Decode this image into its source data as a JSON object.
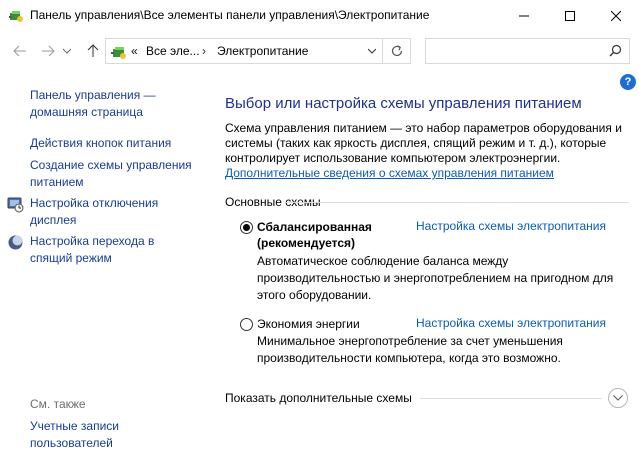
{
  "window": {
    "title": "Панель управления\\Все элементы панели управления\\Электропитание"
  },
  "address": {
    "overflow": "«",
    "crumb1": "Все эле...",
    "crumb2": "Электропитание"
  },
  "search": {
    "placeholder": ""
  },
  "help_label": "?",
  "sidebar": {
    "home": "Панель управления — домашняя страница",
    "links": [
      "Действия кнопок питания",
      "Создание схемы управления питанием",
      "Настройка отключения дисплея",
      "Настройка перехода в спящий режим"
    ],
    "see_also": "См. также",
    "user_accounts": "Учетные записи пользователей"
  },
  "main": {
    "title": "Выбор или настройка схемы управления питанием",
    "intro": "Схема управления питанием — это набор параметров оборудования и системы (таких как яркость дисплея, спящий режим и т. д.), которые контролирует использование компьютером электроэнергии.",
    "more_link": "Дополнительные сведения о схемах управления питанием",
    "section_label": "Основные схемы",
    "plans": [
      {
        "name": "Сбалансированная (рекомендуется)",
        "settings": "Настройка схемы электропитания",
        "description": "Автоматическое соблюдение баланса между производительностью и энергопотреблением на пригодном для этого оборудовании.",
        "selected": true
      },
      {
        "name": "Экономия энергии",
        "settings": "Настройка схемы электропитания",
        "description": "Минимальное энергопотребление за счет уменьшения производительности компьютера, когда это возможно.",
        "selected": false
      }
    ],
    "show_more": "Показать дополнительные схемы"
  },
  "colors": {
    "link": "#0b5cad",
    "heading": "#1e3287",
    "sidebar_link": "#1a3b8f"
  }
}
